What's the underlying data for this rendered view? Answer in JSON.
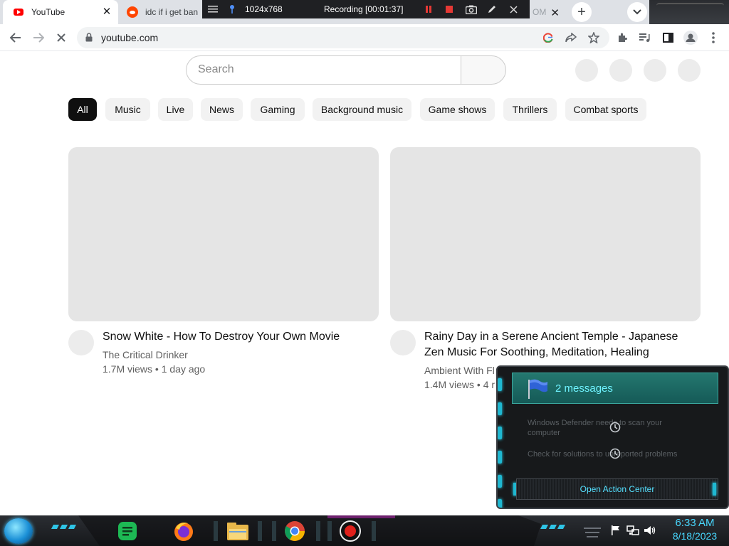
{
  "browser": {
    "tabs": [
      {
        "title": "YouTube",
        "favicon": "youtube-icon",
        "active": true
      },
      {
        "title": "idc if i get ban",
        "favicon": "reddit-icon",
        "active": false
      },
      {
        "title": "ОМ",
        "favicon": "",
        "active": false
      }
    ],
    "url": "youtube.com"
  },
  "recorder": {
    "resolution": "1024x768",
    "status": "Recording [00:01:37]"
  },
  "youtube": {
    "search_placeholder": "Search",
    "chips": [
      "All",
      "Music",
      "Live",
      "News",
      "Gaming",
      "Background music",
      "Game shows",
      "Thrillers",
      "Combat sports"
    ],
    "videos": [
      {
        "title": "Snow White - How To Destroy Your Own Movie",
        "channel": "The Critical Drinker",
        "meta": "1.7M views • 1 day ago"
      },
      {
        "title": "Rainy Day in a Serene Ancient Temple - Japanese Zen Music For Soothing, Meditation, Healing",
        "channel": "Ambient With Fl",
        "meta": "1.4M views • 4 r"
      }
    ]
  },
  "action_center": {
    "header": "2 messages",
    "messages": [
      "Windows Defender needs to scan your computer",
      "Check for solutions to unreported problems"
    ],
    "button": "Open Action Center"
  },
  "taskbar": {
    "time": "6:33 AM",
    "date": "8/18/2023"
  },
  "colors": {
    "accent_cyan": "#48d8ff",
    "youtube_red": "#ff0000"
  }
}
